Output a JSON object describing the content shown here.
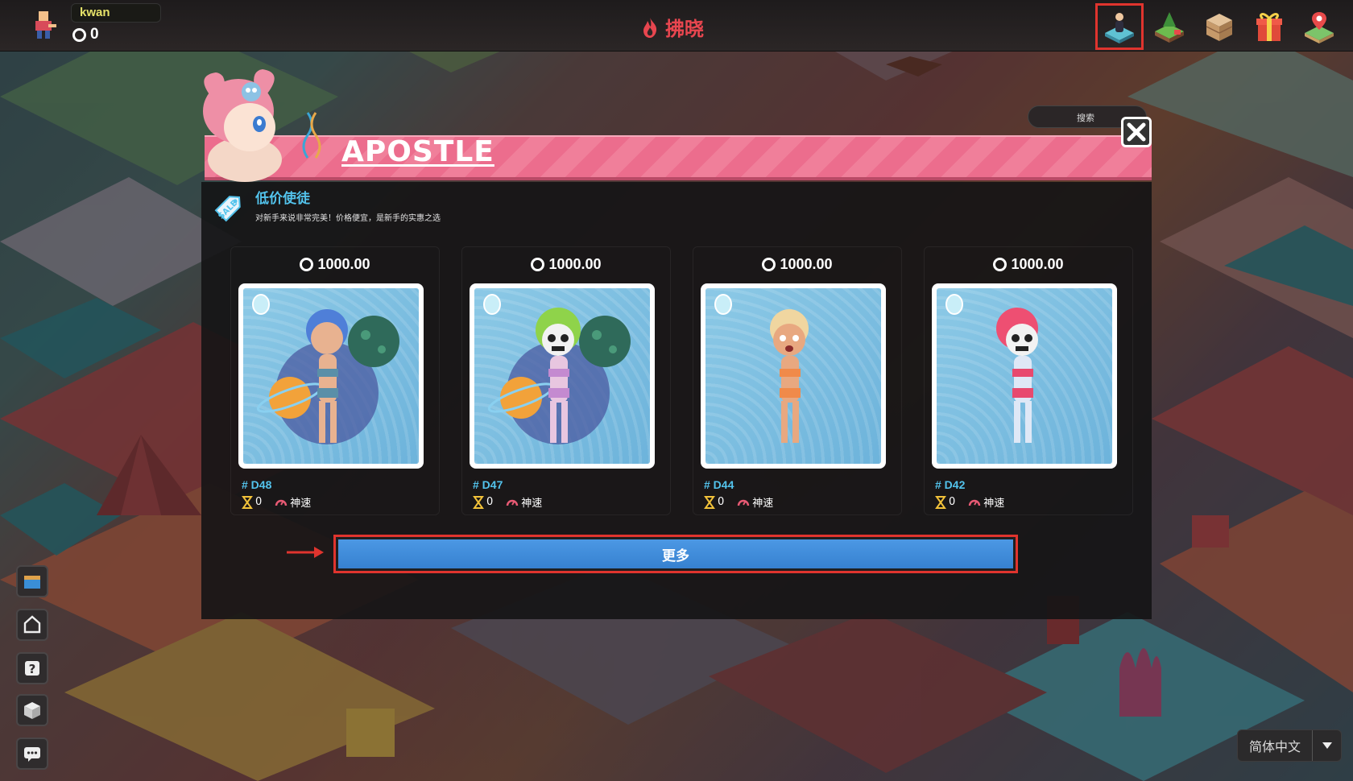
{
  "player": {
    "name": "kwan",
    "balance": "0"
  },
  "land": {
    "name": "拂晓"
  },
  "top_icons": [
    {
      "icon": "apostle-icon",
      "active": true
    },
    {
      "icon": "land-icon",
      "active": false
    },
    {
      "icon": "warehouse-icon",
      "active": false
    },
    {
      "icon": "gift-icon",
      "active": false
    },
    {
      "icon": "map-pin-icon",
      "active": false
    }
  ],
  "market": {
    "title": "APOSTLE",
    "search_placeholder": "搜索",
    "section": {
      "title": "低价使徒",
      "description": "对新手来说非常完美！价格便宜，是新手的实惠之选",
      "tag": "SALE"
    },
    "cards": [
      {
        "price": "1000.00",
        "id": "# D48",
        "stat_value": "0",
        "speed": "神速",
        "hair": "#4f7fd8",
        "skull": false
      },
      {
        "price": "1000.00",
        "id": "# D47",
        "stat_value": "0",
        "speed": "神速",
        "hair": "#8fd34a",
        "skull": true
      },
      {
        "price": "1000.00",
        "id": "# D44",
        "stat_value": "0",
        "speed": "神速",
        "hair": "#f0d6a0",
        "skull": false
      },
      {
        "price": "1000.00",
        "id": "# D42",
        "stat_value": "0",
        "speed": "神速",
        "hair": "#ee4f72",
        "skull": true
      }
    ],
    "more_label": "更多"
  },
  "language": {
    "selected": "简体中文"
  },
  "colors": {
    "accent_blue": "#3a86d6",
    "banner_pink": "#ec6d8d",
    "highlight_red": "#e0342e",
    "label_cyan": "#53c3ec"
  }
}
